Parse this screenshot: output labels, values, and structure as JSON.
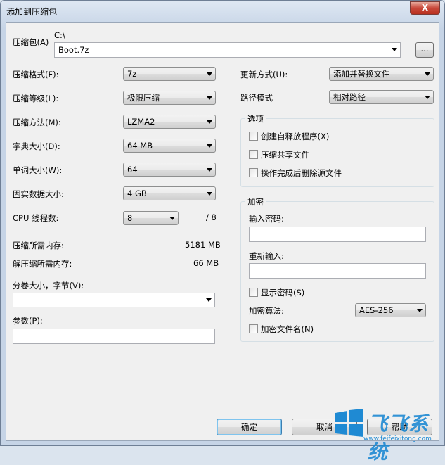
{
  "window": {
    "title": "添加到压缩包",
    "close_label": "X"
  },
  "archive": {
    "label": "压缩包(A)",
    "folder": "C:\\",
    "filename": "Boot.7z",
    "browse_label": "..."
  },
  "left": {
    "format": {
      "label": "压缩格式(F):",
      "value": "7z"
    },
    "level": {
      "label": "压缩等级(L):",
      "value": "极限压缩"
    },
    "method": {
      "label": "压缩方法(M):",
      "value": "LZMA2"
    },
    "dict": {
      "label": "字典大小(D):",
      "value": "64 MB"
    },
    "word": {
      "label": "单词大小(W):",
      "value": "64"
    },
    "solid": {
      "label": "固实数据大小:",
      "value": "4 GB"
    },
    "threads": {
      "label": "CPU 线程数:",
      "value": "8",
      "max": "/ 8"
    },
    "mem_compress": {
      "label": "压缩所需内存:",
      "value": "5181 MB"
    },
    "mem_decompress": {
      "label": "解压缩所需内存:",
      "value": "66 MB"
    },
    "volume": {
      "label": "分卷大小，字节(V):",
      "value": ""
    },
    "params": {
      "label": "参数(P):",
      "value": ""
    }
  },
  "right": {
    "update": {
      "label": "更新方式(U):",
      "value": "添加并替换文件"
    },
    "path": {
      "label": "路径模式",
      "value": "相对路径"
    },
    "options": {
      "title": "选项",
      "items": [
        "创建自释放程序(X)",
        "压缩共享文件",
        "操作完成后删除源文件"
      ]
    },
    "encryption": {
      "title": "加密",
      "password_label": "输入密码:",
      "reenter_label": "重新输入:",
      "show_password": "显示密码(S)",
      "method_label": "加密算法:",
      "method_value": "AES-256",
      "encrypt_names": "加密文件名(N)"
    }
  },
  "buttons": {
    "ok": "确定",
    "cancel": "取消",
    "help": "帮助"
  },
  "watermark": {
    "text": "飞飞系统",
    "url": "www.feifeixitong.com"
  },
  "colors": {
    "accent": "#1f8ad3",
    "close": "#c8483a"
  }
}
